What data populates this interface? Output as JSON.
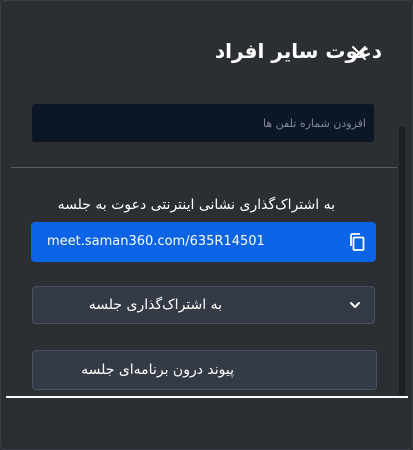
{
  "dialog": {
    "title": "دعوت سایر افراد",
    "close_icon": "close-icon"
  },
  "phone_input": {
    "placeholder": "افزودن شماره تلفن ها",
    "value": ""
  },
  "invite_link": {
    "label": "به اشتراک‌گذاری نشانی اینترنتی دعوت به جلسه",
    "url": "meet.saman360.com/635R14501",
    "copy_icon": "copy-icon",
    "color": "#0b63e5"
  },
  "share_meeting": {
    "label": "به اشتراک‌گذاری جلسه",
    "icon": "chevron-down-icon"
  },
  "in_app_link": {
    "label": "پیوند درون برنامه‌ای جلسه"
  }
}
